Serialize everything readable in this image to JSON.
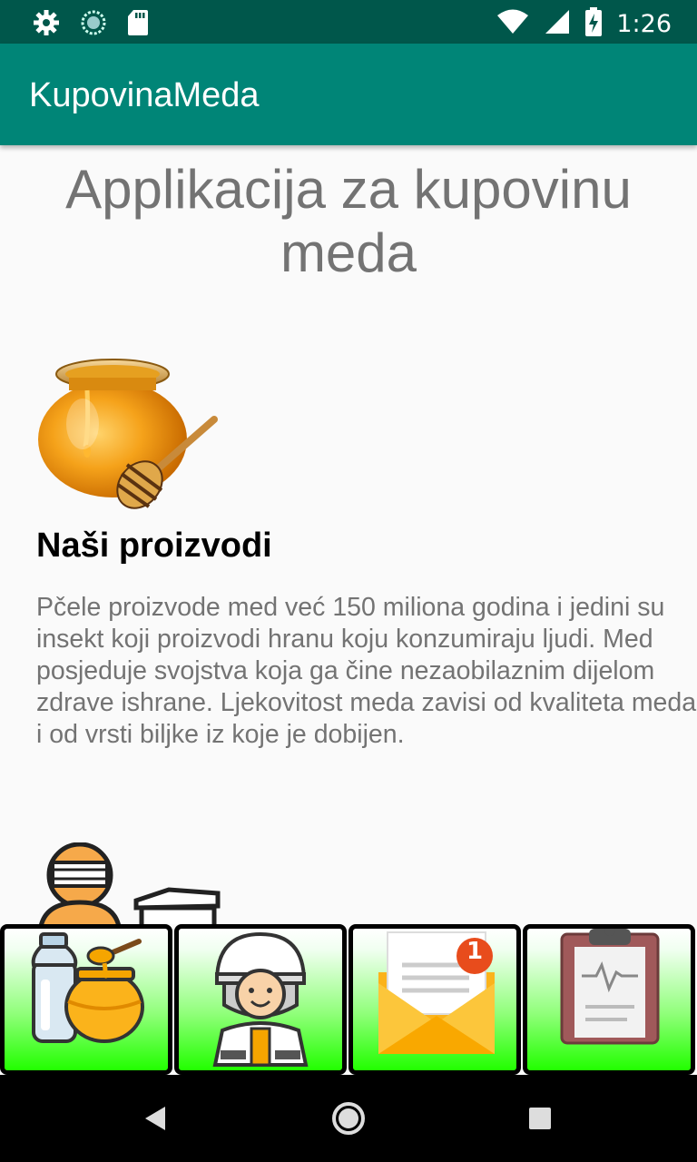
{
  "status_bar": {
    "time": "1:26",
    "left_icons": [
      "gear-icon",
      "loading-icon",
      "sd-card-icon"
    ],
    "right_icons": [
      "wifi-icon",
      "signal-icon",
      "battery-icon"
    ]
  },
  "app_bar": {
    "title": "KupovinaMeda"
  },
  "main": {
    "headline": "Applikacija za kupovinu meda",
    "section_title": "Naši proizvodi",
    "section_body": "Pčele proizvode med već 150 miliona godina i jedini su insekt koji proizvodi hranu koju konzumiraju ljudi. Med posjeduje svojstva koja ga čine nezaobilaznim dijelom zdrave ishrane. Ljekovitost meda zavisi od kvaliteta meda i od vrsti biljke iz koje je dobijen."
  },
  "bottom_nav": {
    "buttons": [
      {
        "icon": "honey-products-icon"
      },
      {
        "icon": "beekeeper-icon"
      },
      {
        "icon": "mail-notification-icon",
        "badge": "1"
      },
      {
        "icon": "clipboard-icon"
      }
    ]
  },
  "system_nav": {
    "icons": [
      "back-icon",
      "home-icon",
      "recents-icon"
    ]
  },
  "colors": {
    "status_bar": "#00574b",
    "app_bar": "#008577",
    "button_gradient_bottom": "#22ff00"
  }
}
